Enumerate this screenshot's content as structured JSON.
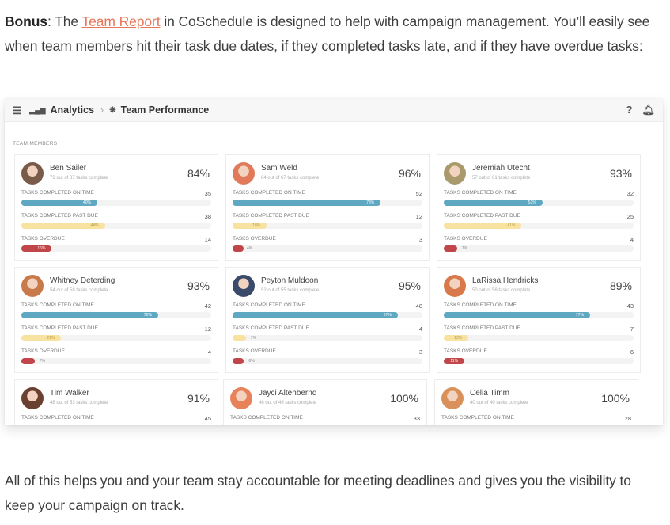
{
  "intro": {
    "bold": "Bonus",
    "before_link": ": The ",
    "link": "Team Report",
    "after_link": " in CoSchedule is designed to help with campaign management. You’ll easily see when team members hit their task due dates, if they completed tasks late, and if they have overdue tasks:"
  },
  "outro": "All of this helps you and your team stay accountable for meeting deadlines and gives you the visibility to keep your campaign on track.",
  "app": {
    "breadcrumb": [
      "Analytics",
      "Team Performance"
    ],
    "section_label": "TEAM MEMBERS",
    "help_icon": "?",
    "labels": {
      "on_time": "TASKS COMPLETED ON TIME",
      "past_due": "TASKS COMPLETED PAST DUE",
      "overdue": "TASKS OVERDUE"
    },
    "colors": {
      "on_time": "#5fa8c2",
      "past_due": "#f8e2a0",
      "overdue": "#c0464a",
      "link": "#e8765a"
    },
    "members": [
      {
        "name": "Ben Sailer",
        "sub": "73 out of 87 tasks complete",
        "pct": "84%",
        "on_time": 35,
        "on_time_pct": 40,
        "past_due": 38,
        "past_due_pct": 44,
        "overdue": 14,
        "overdue_pct": 16,
        "avatar": "#7a5a48"
      },
      {
        "name": "Sam Weld",
        "sub": "64 out of 67 tasks complete",
        "pct": "96%",
        "on_time": 52,
        "on_time_pct": 78,
        "past_due": 12,
        "past_due_pct": 18,
        "overdue": 3,
        "overdue_pct": 4,
        "avatar": "#e07a5a"
      },
      {
        "name": "Jeremiah Utecht",
        "sub": "57 out of 61 tasks complete",
        "pct": "93%",
        "on_time": 32,
        "on_time_pct": 52,
        "past_due": 25,
        "past_due_pct": 41,
        "overdue": 4,
        "overdue_pct": 7,
        "avatar": "#a89a6a"
      },
      {
        "name": "Whitney Deterding",
        "sub": "54 out of 58 tasks complete",
        "pct": "93%",
        "on_time": 42,
        "on_time_pct": 72,
        "past_due": 12,
        "past_due_pct": 21,
        "overdue": 4,
        "overdue_pct": 7,
        "avatar": "#c97a4a"
      },
      {
        "name": "Peyton Muldoon",
        "sub": "52 out of 55 tasks complete",
        "pct": "95%",
        "on_time": 48,
        "on_time_pct": 87,
        "past_due": 4,
        "past_due_pct": 7,
        "overdue": 3,
        "overdue_pct": 6,
        "avatar": "#3a4a6a"
      },
      {
        "name": "LaRissa Hendricks",
        "sub": "50 out of 56 tasks complete",
        "pct": "89%",
        "on_time": 43,
        "on_time_pct": 77,
        "past_due": 7,
        "past_due_pct": 13,
        "overdue": 6,
        "overdue_pct": 11,
        "avatar": "#d9784a"
      },
      {
        "name": "Tim Walker",
        "sub": "48 out of 53 tasks complete",
        "pct": "91%",
        "on_time": 45,
        "avatar": "#6a4030"
      },
      {
        "name": "Jayci Altenbernd",
        "sub": "46 out of 46 tasks complete",
        "pct": "100%",
        "on_time": 33,
        "avatar": "#e8825a"
      },
      {
        "name": "Celia Timm",
        "sub": "40 out of 40 tasks complete",
        "pct": "100%",
        "on_time": 28,
        "avatar": "#d9905a"
      }
    ]
  }
}
